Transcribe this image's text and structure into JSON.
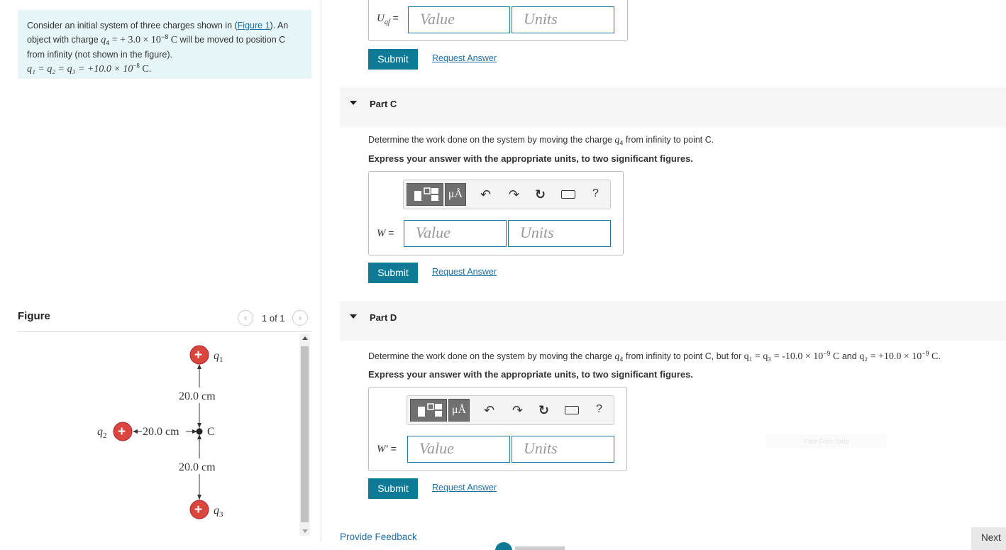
{
  "problem": {
    "text1": "Consider an initial system of three charges shown in (",
    "figure_link": "Figure 1",
    "text2": "). An object with charge ",
    "q4_sym": "q",
    "q4_sub": "4",
    "q4_eq": " = + 3.0 × 10",
    "q4_exp": "−8",
    "q4_unit": " C",
    "text3": " will be moved to position C from infinity (not shown in the figure).",
    "charges_expr": "q₁ = q₂ = q₃ = +10.0 × 10",
    "charges_exp": "−8",
    "charges_unit": " C."
  },
  "figure": {
    "title": "Figure",
    "counter": "1 of 1",
    "prev_icon": "chevron-left-icon",
    "next_icon": "chevron-right-icon",
    "q1_label": "q",
    "q1_sub": "1",
    "q2_label": "q",
    "q2_sub": "2",
    "q3_label": "q",
    "q3_sub": "3",
    "c_label": "C",
    "dist_top": "20.0 cm",
    "dist_left": "20.0 cm",
    "dist_bottom": "20.0 cm",
    "charge_symbol": "+"
  },
  "part_b": {
    "var_label": "U",
    "var_sub": "qf",
    "eq": " =",
    "value_placeholder": "Value",
    "units_placeholder": "Units",
    "submit": "Submit",
    "request": "Request Answer"
  },
  "part_c": {
    "title": "Part C",
    "question_pre": "Determine the work done on the system by moving the charge ",
    "question_sym": "q",
    "question_sub": "4",
    "question_post": " from infinity to point C.",
    "instruction": "Express your answer with the appropriate units, to two significant figures.",
    "toolbar_mu": "μÅ",
    "toolbar_help": "?",
    "var_label": "W",
    "eq": " =",
    "value_placeholder": "Value",
    "units_placeholder": "Units",
    "submit": "Submit",
    "request": "Request Answer"
  },
  "part_d": {
    "title": "Part D",
    "question_pre": "Determine the work done on the system by moving the charge ",
    "question_sym": "q",
    "question_sub": "4",
    "question_mid": " from infinity to point C, but for ",
    "q1q3": "q₁ = q₃ = -10.0 × 10",
    "exp1": "−9",
    "unit1": " C",
    "and": " and ",
    "q2": "q₂ = +10.0 × 10",
    "exp2": "−9",
    "unit2": " C.",
    "instruction": "Express your answer with the appropriate units, to two significant figures.",
    "toolbar_mu": "μÅ",
    "toolbar_help": "?",
    "var_label": "W′",
    "eq": " =",
    "value_placeholder": "Value",
    "units_placeholder": "Units",
    "submit": "Submit",
    "request": "Request Answer"
  },
  "footer": {
    "feedback": "Provide Feedback",
    "next": "Next"
  },
  "ghost_text": "Free Form Strip",
  "colors": {
    "accent": "#0e7a95",
    "problem_bg": "#e6f6f8",
    "charge_red": "#d9463d",
    "link": "#1a6fa6"
  }
}
